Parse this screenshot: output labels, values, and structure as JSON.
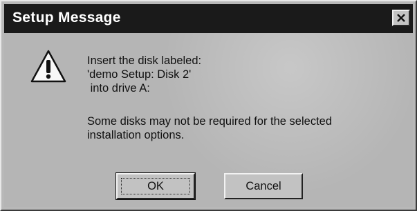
{
  "window": {
    "title": "Setup Message",
    "close_icon": "close-icon"
  },
  "message": {
    "icon": "warning-icon",
    "lines": [
      "Insert the disk labeled:",
      "'demo Setup: Disk 2'",
      " into drive A:",
      "Some disks may not be required for the selected",
      "installation options."
    ]
  },
  "buttons": {
    "ok_label": "OK",
    "cancel_label": "Cancel"
  }
}
